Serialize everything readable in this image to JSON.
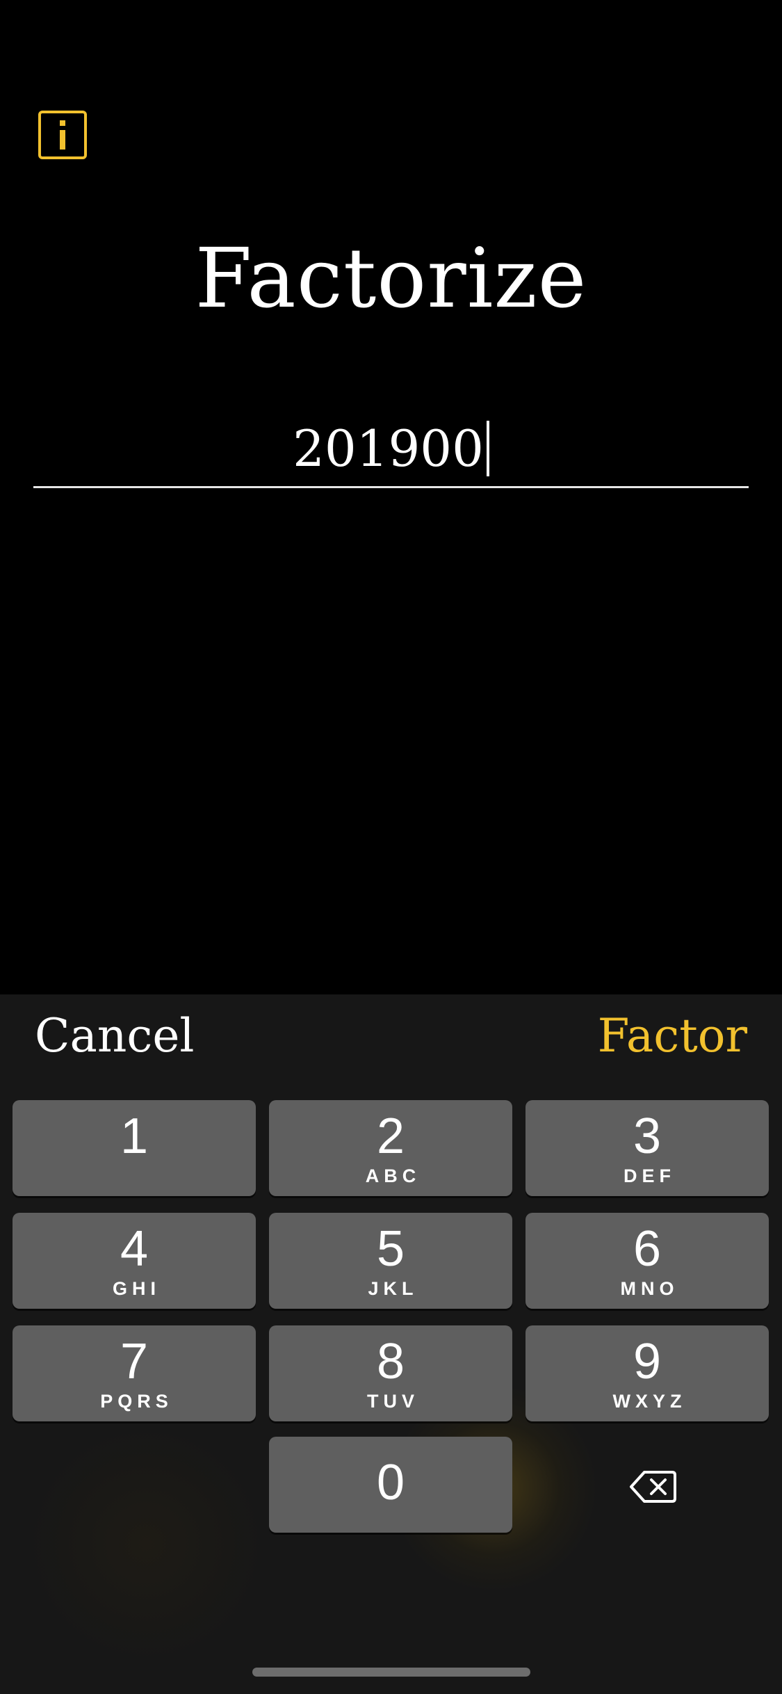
{
  "header": {
    "info_icon": "info-icon",
    "title": "Factorize"
  },
  "input": {
    "value": "201900"
  },
  "accessory_bar": {
    "cancel_label": "Cancel",
    "factor_label": "Factor"
  },
  "keypad": {
    "keys": [
      {
        "digit": "1",
        "letters": ""
      },
      {
        "digit": "2",
        "letters": "ABC"
      },
      {
        "digit": "3",
        "letters": "DEF"
      },
      {
        "digit": "4",
        "letters": "GHI"
      },
      {
        "digit": "5",
        "letters": "JKL"
      },
      {
        "digit": "6",
        "letters": "MNO"
      },
      {
        "digit": "7",
        "letters": "PQRS"
      },
      {
        "digit": "8",
        "letters": "TUV"
      },
      {
        "digit": "9",
        "letters": "WXYZ"
      },
      {
        "digit": "0",
        "letters": ""
      }
    ],
    "delete_icon": "backspace-icon"
  },
  "colors": {
    "accent": "#F2C12E",
    "background": "#000000",
    "keyboard_background": "#171717",
    "key": "#5F5F5F"
  }
}
